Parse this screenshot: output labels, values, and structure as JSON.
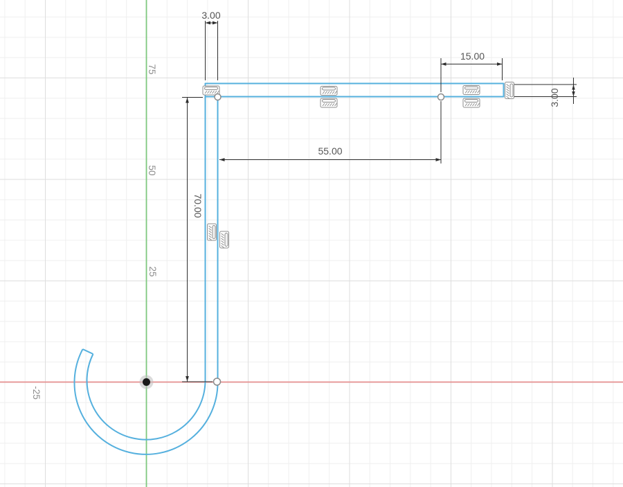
{
  "app": {
    "view": "cad-sketch-canvas"
  },
  "axis_labels": {
    "y_75": "75",
    "y_50": "50",
    "y_25": "25",
    "x_neg_25": "-25"
  },
  "dimensions": {
    "top_thickness": "3.00",
    "end_offset": "15.00",
    "bar_length": "55.00",
    "height": "70.00",
    "right_thickness": "3.00"
  },
  "icons": {
    "constraint_badge": "hatched-line-constraint-icon",
    "origin_point": "filled-origin-dot",
    "sketch_point": "open-circle-point"
  },
  "colors": {
    "sketch_line": "#55b0de",
    "axis_x": "#e68f8f",
    "axis_y": "#7fc97f",
    "dimension": "#2e2e2e",
    "grid_minor": "#efefef",
    "grid_major": "#dedede",
    "label": "#8f8f8f",
    "dim_text": "#555555",
    "badge": "#8e8e8e"
  }
}
